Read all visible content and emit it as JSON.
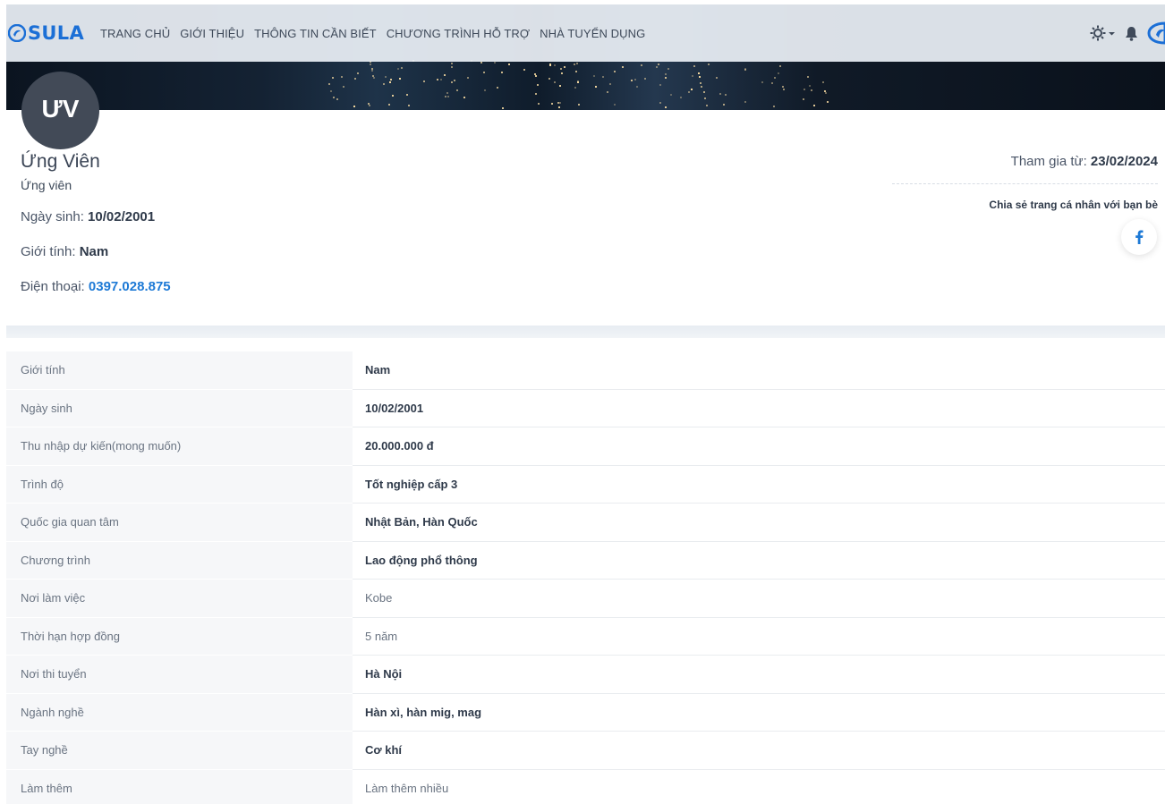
{
  "brand": {
    "name": "SULA",
    "color": "#1b6fd6"
  },
  "nav": {
    "items": [
      "TRANG CHỦ",
      "GIỚI THIỆU",
      "THÔNG TIN CẦN BIẾT",
      "CHƯƠNG TRÌNH HỖ TRỢ",
      "NHÀ TUYỂN DỤNG"
    ],
    "icons": [
      "settings-icon",
      "chevron-down-icon",
      "bell-icon",
      "user-logo-icon"
    ]
  },
  "profile": {
    "avatar_initials": "ƯV",
    "name": "Ứng Viên",
    "role": "Ứng viên",
    "dob_label": "Ngày sinh: ",
    "dob": "10/02/2001",
    "gender_label": "Giới tính: ",
    "gender": "Nam",
    "phone_label": "Điện thoại: ",
    "phone": "0397.028.875",
    "joined_label": "Tham gia từ: ",
    "joined": "23/02/2024",
    "share_text": "Chia sẻ trang cá nhân với bạn bè"
  },
  "details": [
    {
      "label": "Giới tính",
      "value": "Nam",
      "bold": true
    },
    {
      "label": "Ngày sinh",
      "value": "10/02/2001",
      "bold": true
    },
    {
      "label": "Thu nhập dự kiến(mong muốn)",
      "value": "20.000.000 đ",
      "bold": true
    },
    {
      "label": "Trình độ",
      "value": "Tốt nghiệp cấp 3",
      "bold": true
    },
    {
      "label": "Quốc gia quan tâm",
      "value": "Nhật Bản, Hàn Quốc",
      "bold": true
    },
    {
      "label": "Chương trình",
      "value": "Lao động phổ thông",
      "bold": true
    },
    {
      "label": "Nơi làm việc",
      "value": "Kobe",
      "bold": false
    },
    {
      "label": "Thời hạn hợp đồng",
      "value": "5 năm",
      "bold": false
    },
    {
      "label": "Nơi thi tuyển",
      "value": "Hà Nội",
      "bold": true
    },
    {
      "label": "Ngành nghề",
      "value": "Hàn xì, hàn mig, mag",
      "bold": true
    },
    {
      "label": "Tay nghề",
      "value": "Cơ khí",
      "bold": true
    },
    {
      "label": "Làm thêm",
      "value": "Làm thêm nhiều",
      "bold": false
    }
  ]
}
